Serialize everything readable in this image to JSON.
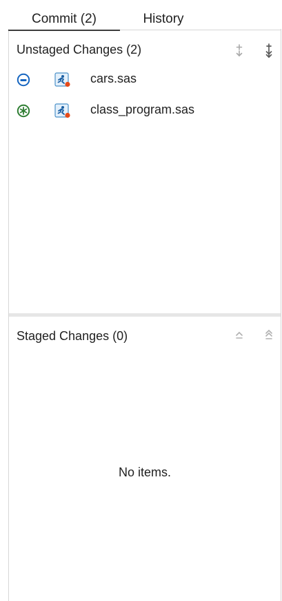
{
  "tabs": [
    {
      "label": "Commit (2)",
      "selected": true
    },
    {
      "label": "History",
      "selected": false
    }
  ],
  "unstaged": {
    "title": "Unstaged Changes (2)",
    "stage_icon": "stage-selected-icon",
    "stage_all_icon": "stage-all-icon",
    "files": [
      {
        "name": "cars.sas",
        "status_icon": "modified-status-icon",
        "status_color": "#1565c0",
        "file_icon": "sas-program-icon"
      },
      {
        "name": "class_program.sas",
        "status_icon": "new-file-status-icon",
        "status_color": "#2e7d32",
        "file_icon": "sas-program-icon"
      }
    ]
  },
  "staged": {
    "title": "Staged Changes (0)",
    "unstage_icon": "unstage-selected-icon",
    "unstage_all_icon": "unstage-all-icon",
    "empty_text": "No items."
  }
}
